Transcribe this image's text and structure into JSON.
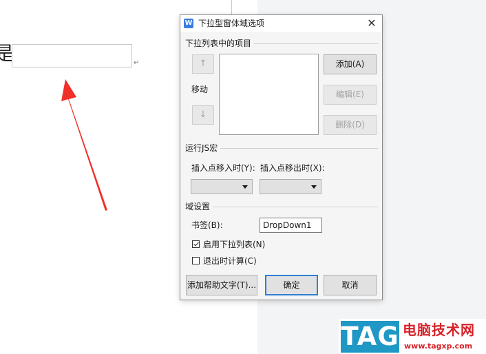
{
  "document": {
    "visible_char": "是",
    "para_mark": "↵"
  },
  "dialog": {
    "title": "下拉型窗体域选项",
    "close_glyph": "✕",
    "list_section": {
      "label": "下拉列表中的项目",
      "move_label": "移动",
      "up_glyph": "↑",
      "down_glyph": "↓",
      "add_label": "添加(A)",
      "edit_label": "编辑(E)",
      "delete_label": "删除(D)"
    },
    "macro_section": {
      "label": "运行JS宏",
      "entry_label": "插入点移入时(Y):",
      "exit_label": "插入点移出时(X):",
      "entry_value": "",
      "exit_value": ""
    },
    "field_section": {
      "label": "域设置",
      "bookmark_label": "书签(B):",
      "bookmark_value": "DropDown1",
      "enable_dropdown_label": "启用下拉列表(N)",
      "enable_dropdown_checked": true,
      "calc_on_exit_label": "退出时计算(C)",
      "calc_on_exit_checked": false
    },
    "footer": {
      "help_text_label": "添加帮助文字(T)...",
      "ok_label": "确定",
      "cancel_label": "取消"
    }
  },
  "watermark": {
    "tag": "TAG",
    "site_name": "电脑技术网",
    "url": "www.tagxp.com"
  },
  "colors": {
    "arrow": "#f0302a",
    "accent": "#2e7fd1",
    "logo_blue": "#1f98c5",
    "logo_red": "#d6232a"
  }
}
